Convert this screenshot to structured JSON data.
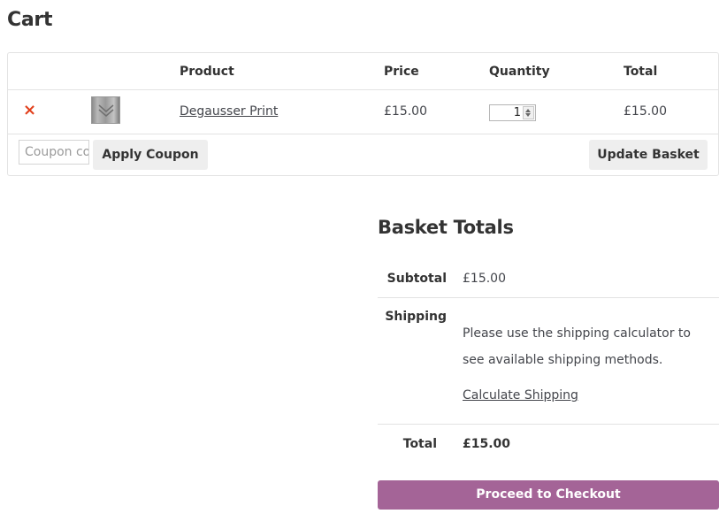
{
  "page": {
    "title": "Cart"
  },
  "cart": {
    "headers": {
      "product": "Product",
      "price": "Price",
      "quantity": "Quantity",
      "total": "Total"
    },
    "items": [
      {
        "remove_symbol": "×",
        "thumbnail_icon": "product-thumbnail-icon",
        "name": "Degausser Print",
        "price": "£15.00",
        "quantity": "1",
        "total": "£15.00"
      }
    ],
    "coupon": {
      "placeholder": "Coupon code",
      "apply_label": "Apply Coupon"
    },
    "update_label": "Update Basket"
  },
  "totals": {
    "title": "Basket Totals",
    "subtotal_label": "Subtotal",
    "subtotal_value": "£15.00",
    "shipping_label": "Shipping",
    "shipping_text": "Please use the shipping calculator to see available shipping methods.",
    "shipping_calc_label": "Calculate Shipping",
    "total_label": "Total",
    "total_value": "£15.00",
    "checkout_label": "Proceed to Checkout"
  },
  "colors": {
    "accent": "#a46497",
    "remove": "#e2401c",
    "button_gray": "#eeeeee",
    "border": "#e3e3e3"
  }
}
